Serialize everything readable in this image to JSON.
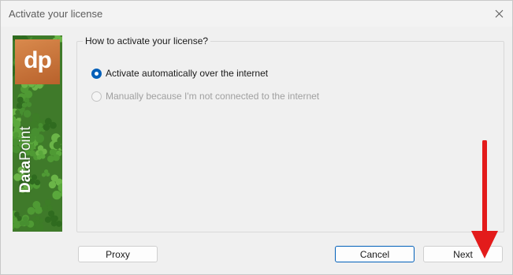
{
  "window": {
    "title": "Activate your license",
    "close_icon": "close-icon"
  },
  "banner": {
    "logo_text": "dp",
    "brand_bold": "Data",
    "brand_light": "Point",
    "background": "clover-leaves-image"
  },
  "group": {
    "legend": "How to activate your license?",
    "options": [
      {
        "label": "Activate automatically over the internet",
        "checked": true,
        "enabled": true
      },
      {
        "label": "Manually because I'm not connected to the internet",
        "checked": false,
        "enabled": false
      }
    ]
  },
  "buttons": {
    "proxy": "Proxy",
    "cancel": "Cancel",
    "next": "Next"
  },
  "annotation": {
    "arrow_color": "#e31b1b",
    "points_to": "Next"
  },
  "colors": {
    "accent": "#005fb8",
    "logo": "#c9703b"
  }
}
